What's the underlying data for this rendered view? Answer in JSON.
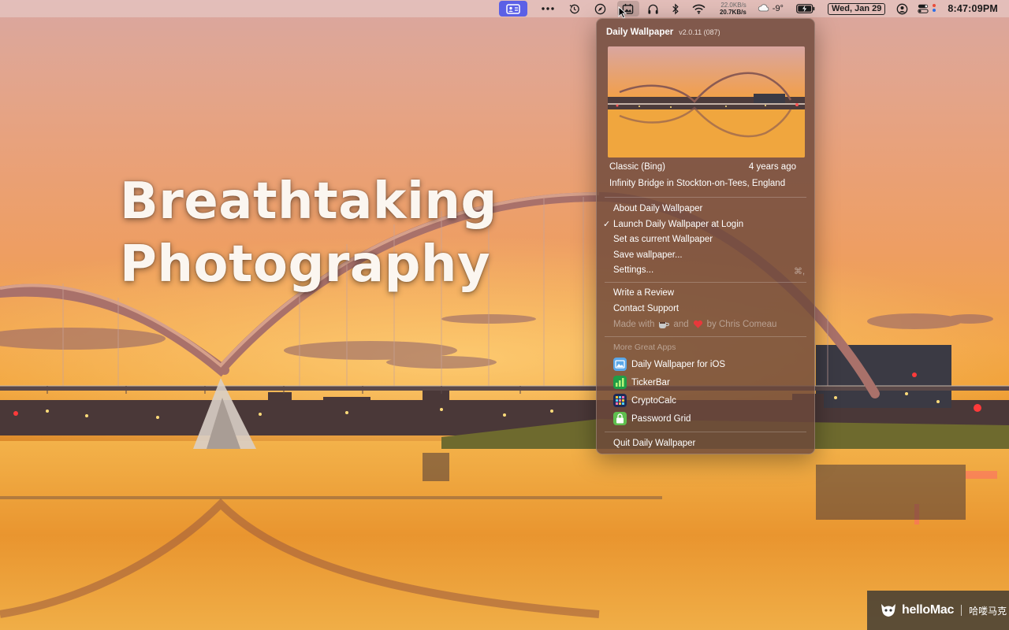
{
  "wallpaper": {
    "headline_line1": "Breathtaking",
    "headline_line2": "Photography"
  },
  "menubar": {
    "icons": [
      "user-card-icon",
      "more-dots-icon",
      "history-icon",
      "compass-icon",
      "daily-wallpaper-icon",
      "headphones-icon",
      "bluetooth-icon",
      "wifi-icon"
    ],
    "net_up": "22.0KB/s",
    "net_down": "20.7KB/s",
    "temperature": "-9°",
    "date": "Wed, Jan 29",
    "time": "8:47:09PM"
  },
  "menu": {
    "title": "Daily Wallpaper",
    "version": "v2.0.11 (087)",
    "source": "Classic (Bing)",
    "age": "4 years ago",
    "location": "Infinity Bridge in Stockton-on-Tees, England",
    "items_group1": [
      {
        "label": "About Daily Wallpaper",
        "checked": false
      },
      {
        "label": "Launch Daily Wallpaper at Login",
        "checked": true
      },
      {
        "label": "Set as current Wallpaper",
        "checked": false
      },
      {
        "label": "Save wallpaper...",
        "checked": false
      },
      {
        "label": "Settings...",
        "checked": false,
        "shortcut": "⌘,"
      }
    ],
    "items_group2": [
      {
        "label": "Write a Review"
      },
      {
        "label": "Contact Support"
      }
    ],
    "made_with": {
      "prefix": "Made with",
      "middle": "and",
      "suffix": "by Chris Comeau"
    },
    "more_apps_header": "More Great Apps",
    "apps": [
      {
        "label": "Daily Wallpaper for iOS",
        "icon": "daily-wallpaper-ios-icon",
        "color": "#5aa7e8"
      },
      {
        "label": "TickerBar",
        "icon": "tickerbar-icon",
        "color": "#1f9e47"
      },
      {
        "label": "CryptoCalc",
        "icon": "cryptocalc-icon",
        "color": "#1e2a55"
      },
      {
        "label": "Password Grid",
        "icon": "password-grid-icon",
        "color": "#5fbf4e"
      }
    ],
    "quit": "Quit Daily Wallpaper"
  },
  "watermark": {
    "brand": "helloMac",
    "cn": "哈喽马克"
  },
  "colors": {
    "menu_bg": "#6c483a",
    "menubar_active": "#5b60e6",
    "sky_top": "#d9a7a0",
    "water": "#f0a036"
  }
}
